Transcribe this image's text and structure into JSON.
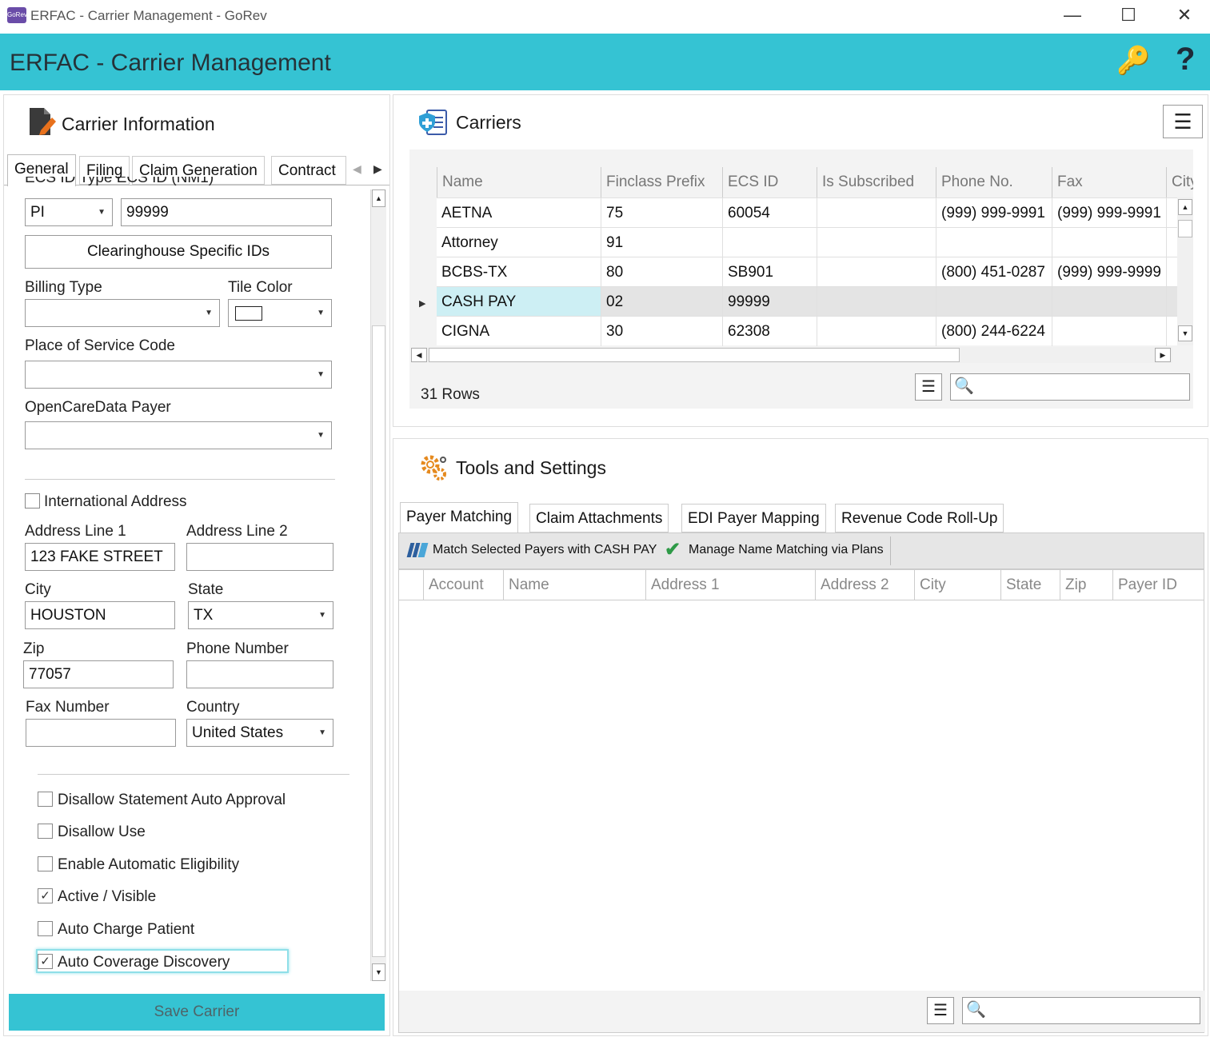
{
  "window": {
    "title": "ERFAC - Carrier Management - GoRev",
    "icon": "gorev-app-icon",
    "app_icon_text": "GoRev"
  },
  "header": {
    "title": "ERFAC - Carrier Management"
  },
  "carrier_info": {
    "title": "Carrier Information",
    "tabs": [
      "General",
      "Filing",
      "Claim Generation",
      "Contract"
    ],
    "ecs_id_type_label": "ECS ID Type  ECS ID (NM1)",
    "ecs_id_type": "PI",
    "ecs_id": "99999",
    "clearinghouse_button": "Clearinghouse Specific IDs",
    "billing_type_label": "Billing Type",
    "billing_type": "",
    "tile_color_label": "Tile Color",
    "place_of_service_label": "Place of Service Code",
    "place_of_service": "",
    "opencaredata_label": "OpenCareData Payer",
    "opencaredata": "",
    "international_label": "International Address",
    "address1_label": "Address Line 1",
    "address1": "123 FAKE STREET",
    "address2_label": "Address Line 2",
    "address2": "",
    "city_label": "City",
    "city": "HOUSTON",
    "state_label": "State",
    "state": "TX",
    "zip_label": "Zip",
    "zip": "77057",
    "phone_label": "Phone Number",
    "phone": "",
    "fax_label": "Fax Number",
    "fax": "",
    "country_label": "Country",
    "country": "United States",
    "checkboxes": [
      {
        "label": "Disallow Statement Auto Approval",
        "checked": false
      },
      {
        "label": "Disallow Use",
        "checked": false
      },
      {
        "label": "Enable Automatic Eligibility",
        "checked": false
      },
      {
        "label": "Active / Visible",
        "checked": true
      },
      {
        "label": "Auto Charge Patient",
        "checked": false
      },
      {
        "label": "Auto Coverage Discovery",
        "checked": true
      }
    ],
    "save_button": "Save Carrier"
  },
  "carriers": {
    "title": "Carriers",
    "columns": [
      "Name",
      "Finclass Prefix",
      "ECS ID",
      "Is Subscribed",
      "Phone No.",
      "Fax",
      "City"
    ],
    "rows": [
      {
        "name": "AETNA",
        "prefix": "75",
        "ecs": "60054",
        "sub": "",
        "phone": "(999) 999-9991",
        "fax": "(999) 999-9991",
        "city": ""
      },
      {
        "name": "Attorney",
        "prefix": "91",
        "ecs": "",
        "sub": "",
        "phone": "",
        "fax": "",
        "city": ""
      },
      {
        "name": "BCBS-TX",
        "prefix": "80",
        "ecs": "SB901",
        "sub": "",
        "phone": "(800) 451-0287",
        "fax": "(999) 999-9999",
        "city": ""
      },
      {
        "name": "CASH PAY",
        "prefix": "02",
        "ecs": "99999",
        "sub": "",
        "phone": "",
        "fax": "",
        "city": ""
      },
      {
        "name": "CIGNA",
        "prefix": "30",
        "ecs": "62308",
        "sub": "",
        "phone": "(800) 244-6224",
        "fax": "",
        "city": ""
      }
    ],
    "row_count": "31 Rows"
  },
  "tools": {
    "title": "Tools and Settings",
    "tabs": [
      "Payer Matching",
      "Claim Attachments",
      "EDI Payer Mapping",
      "Revenue Code Roll-Up"
    ],
    "toolbar": {
      "match_label": "Match Selected Payers with CASH PAY",
      "manage_label": "Manage Name Matching via Plans"
    },
    "columns": [
      "Account",
      "Name",
      "Address 1",
      "Address 2",
      "City",
      "State",
      "Zip",
      "Payer ID"
    ]
  },
  "colors": {
    "accent": "#35c3d3",
    "selected_row": "#cdeff4"
  }
}
